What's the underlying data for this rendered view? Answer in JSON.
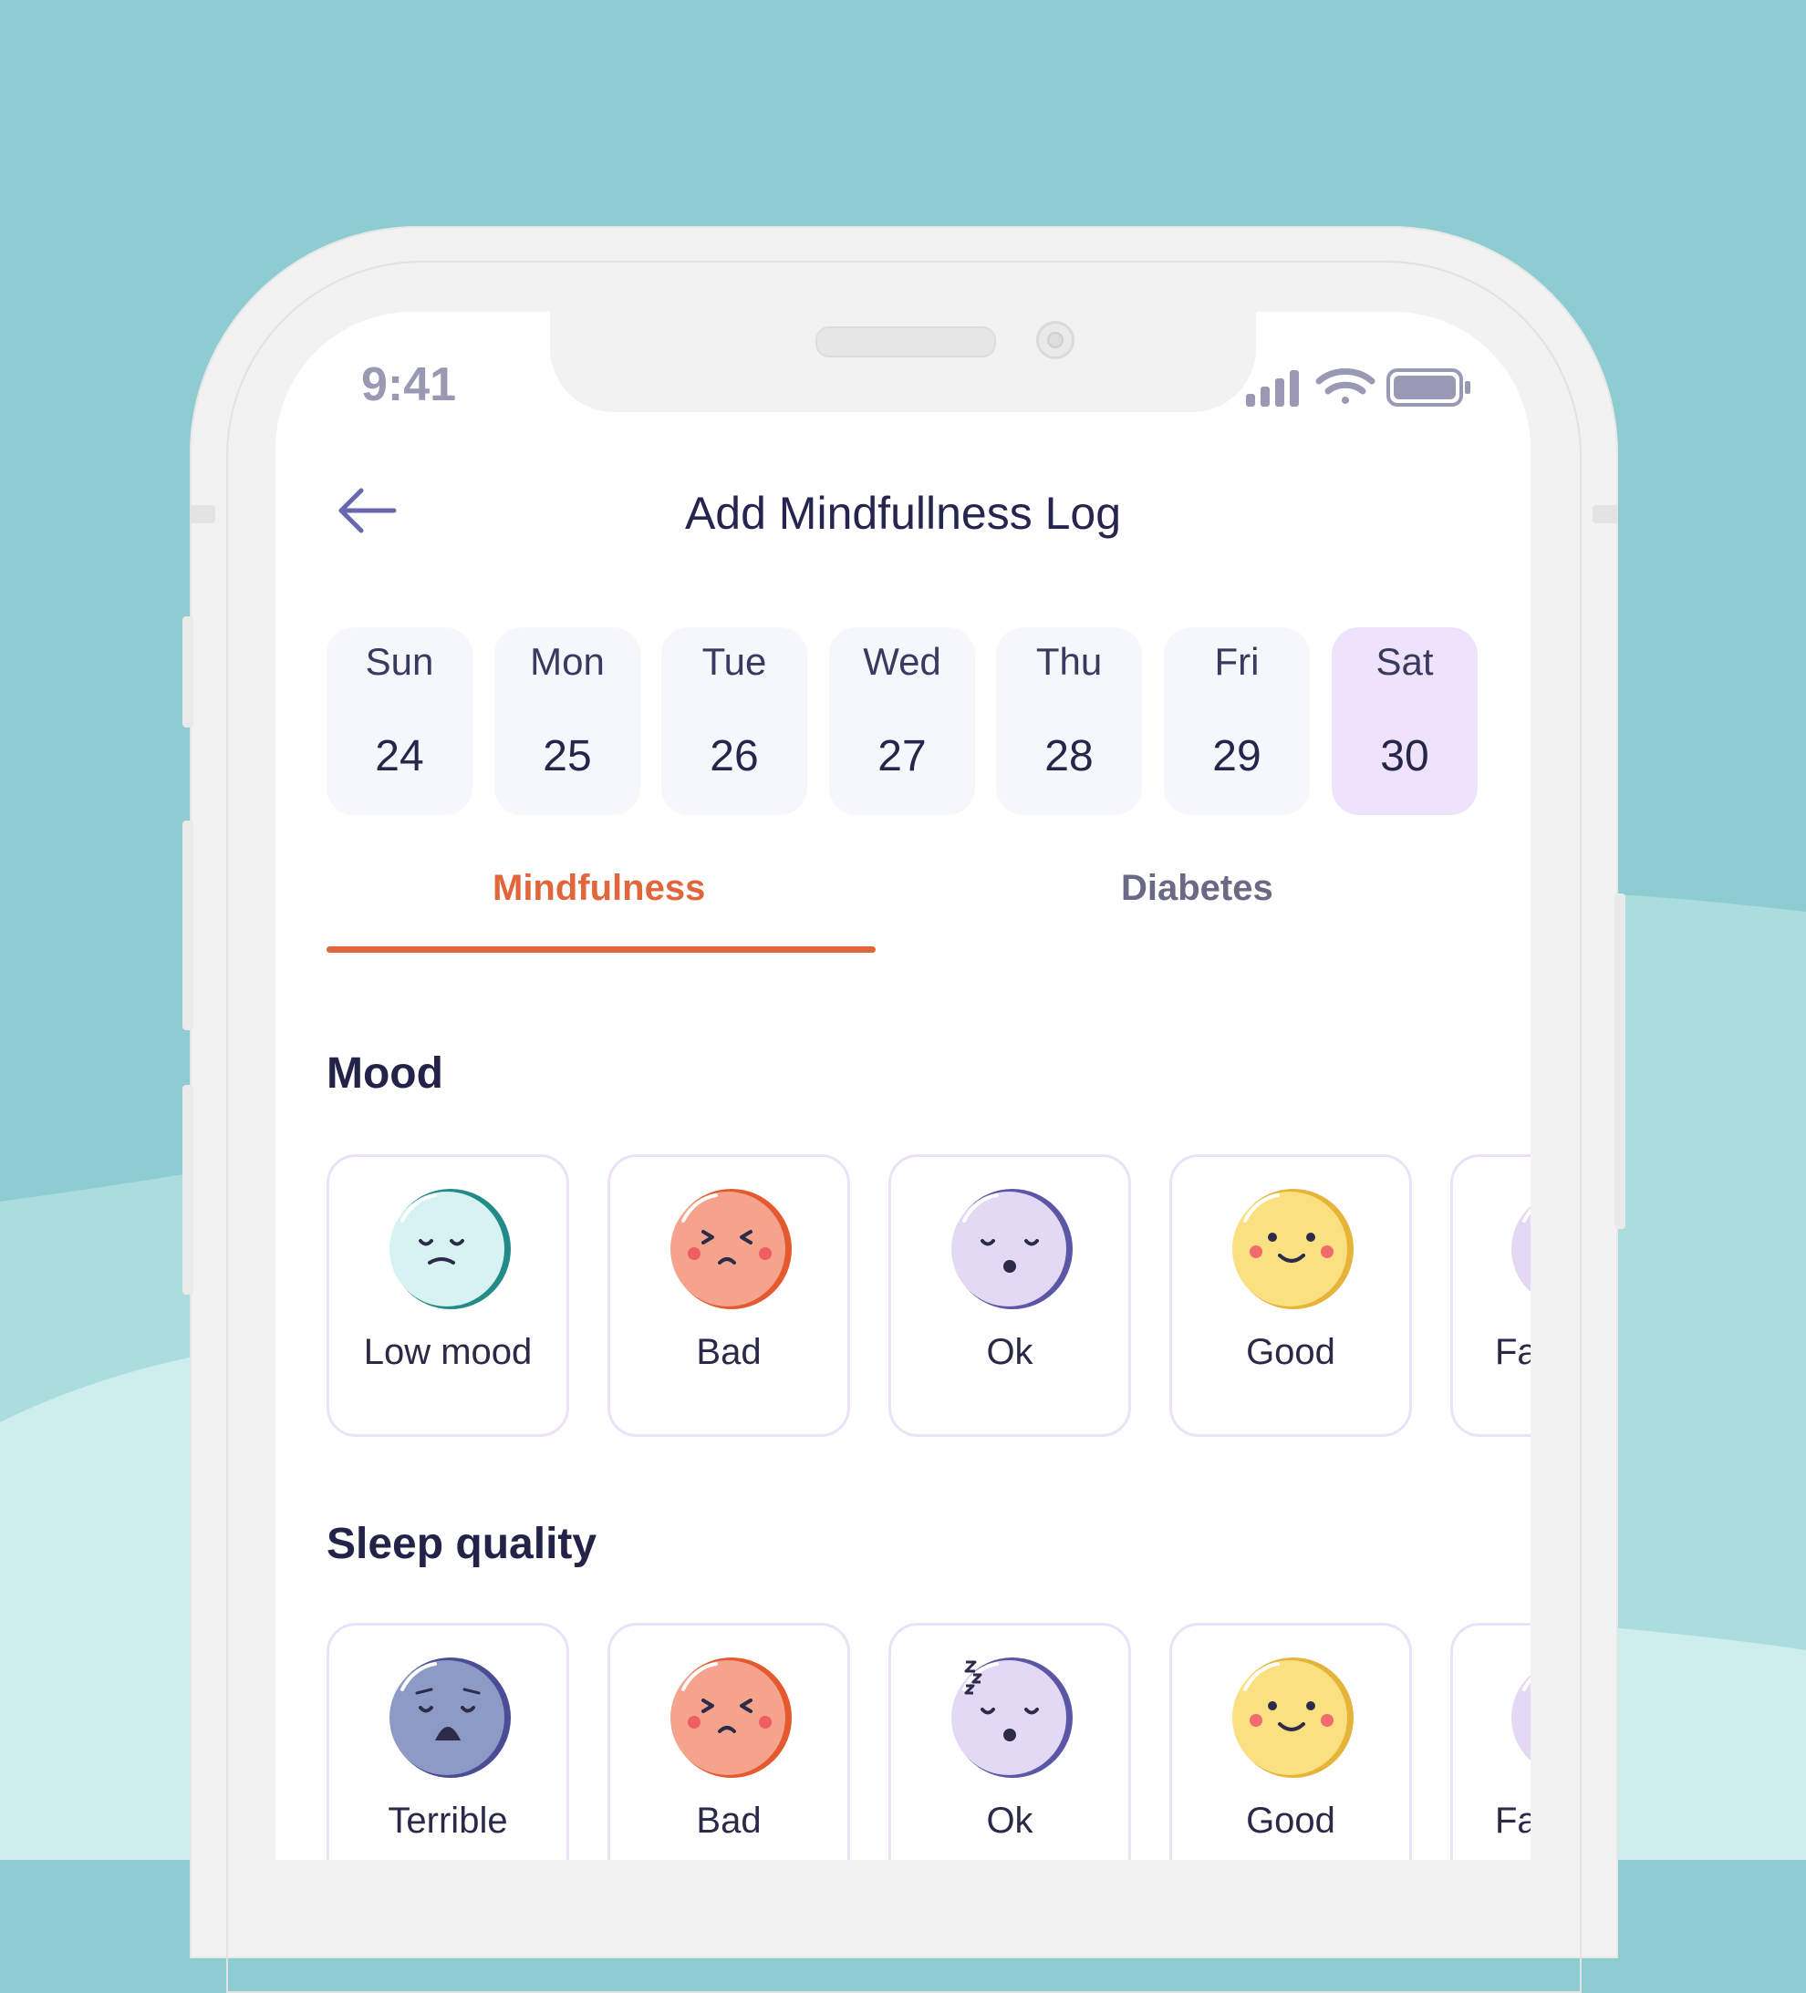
{
  "status_bar": {
    "time": "9:41"
  },
  "header": {
    "title": "Add Mindfullness Log"
  },
  "days": [
    {
      "name": "Sun",
      "num": "24",
      "selected": false
    },
    {
      "name": "Mon",
      "num": "25",
      "selected": false
    },
    {
      "name": "Tue",
      "num": "26",
      "selected": false
    },
    {
      "name": "Wed",
      "num": "27",
      "selected": false
    },
    {
      "name": "Thu",
      "num": "28",
      "selected": false
    },
    {
      "name": "Fri",
      "num": "29",
      "selected": false
    },
    {
      "name": "Sat",
      "num": "30",
      "selected": true
    }
  ],
  "tabs": [
    {
      "label": "Mindfulness",
      "active": true
    },
    {
      "label": "Diabetes",
      "active": false
    }
  ],
  "mood": {
    "title": "Mood",
    "options": [
      {
        "label": "Low mood",
        "icon": "low-mood-face-icon"
      },
      {
        "label": "Bad",
        "icon": "bad-face-icon"
      },
      {
        "label": "Ok",
        "icon": "ok-face-icon"
      },
      {
        "label": "Good",
        "icon": "good-face-icon"
      },
      {
        "label": "Fa",
        "icon": "partial-face-icon"
      }
    ]
  },
  "sleep": {
    "title": "Sleep quality",
    "options": [
      {
        "label": "Terrible",
        "icon": "terrible-face-icon"
      },
      {
        "label": "Bad",
        "icon": "bad-face-icon"
      },
      {
        "label": "Ok",
        "icon": "sleepy-face-icon"
      },
      {
        "label": "Good",
        "icon": "good-face-icon"
      },
      {
        "label": "Fa",
        "icon": "partial-face-icon"
      }
    ]
  },
  "colors": {
    "accent": "#e2663b",
    "background": "#8dcdd2",
    "selected_day": "#efe3fc",
    "day_bg": "#f6f6fd"
  }
}
